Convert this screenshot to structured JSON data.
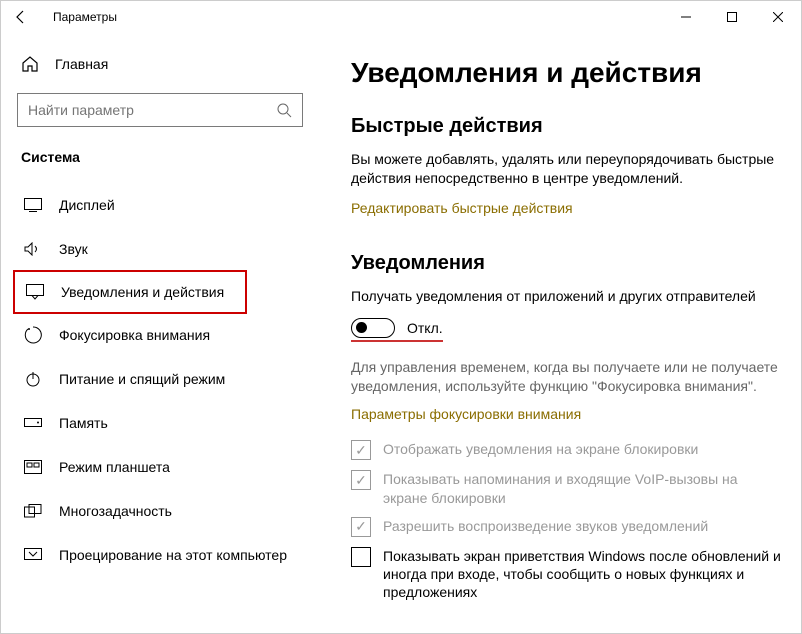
{
  "window": {
    "title": "Параметры"
  },
  "sidebar": {
    "home": "Главная",
    "search_placeholder": "Найти параметр",
    "category": "Система",
    "items": [
      {
        "label": "Дисплей"
      },
      {
        "label": "Звук"
      },
      {
        "label": "Уведомления и действия"
      },
      {
        "label": "Фокусировка внимания"
      },
      {
        "label": "Питание и спящий режим"
      },
      {
        "label": "Память"
      },
      {
        "label": "Режим планшета"
      },
      {
        "label": "Многозадачность"
      },
      {
        "label": "Проецирование на этот компьютер"
      }
    ]
  },
  "main": {
    "title": "Уведомления и действия",
    "quick": {
      "heading": "Быстрые действия",
      "desc": "Вы можете добавлять, удалять или переупорядочивать быстрые действия непосредственно в центре уведомлений.",
      "link": "Редактировать быстрые действия"
    },
    "notif": {
      "heading": "Уведомления",
      "toggle_desc": "Получать уведомления от приложений и других отправителей",
      "toggle_state": "Откл.",
      "focus_hint": "Для управления временем, когда вы получаете или не получаете уведомления, используйте функцию \"Фокусировка внимания\".",
      "focus_link": "Параметры фокусировки внимания",
      "checks": [
        "Отображать уведомления на экране блокировки",
        "Показывать напоминания и входящие VoIP-вызовы на экране блокировки",
        "Разрешить  воспроизведение звуков уведомлений",
        "Показывать экран приветствия Windows после обновлений и иногда при входе, чтобы сообщить о новых функциях и предложениях"
      ]
    }
  }
}
